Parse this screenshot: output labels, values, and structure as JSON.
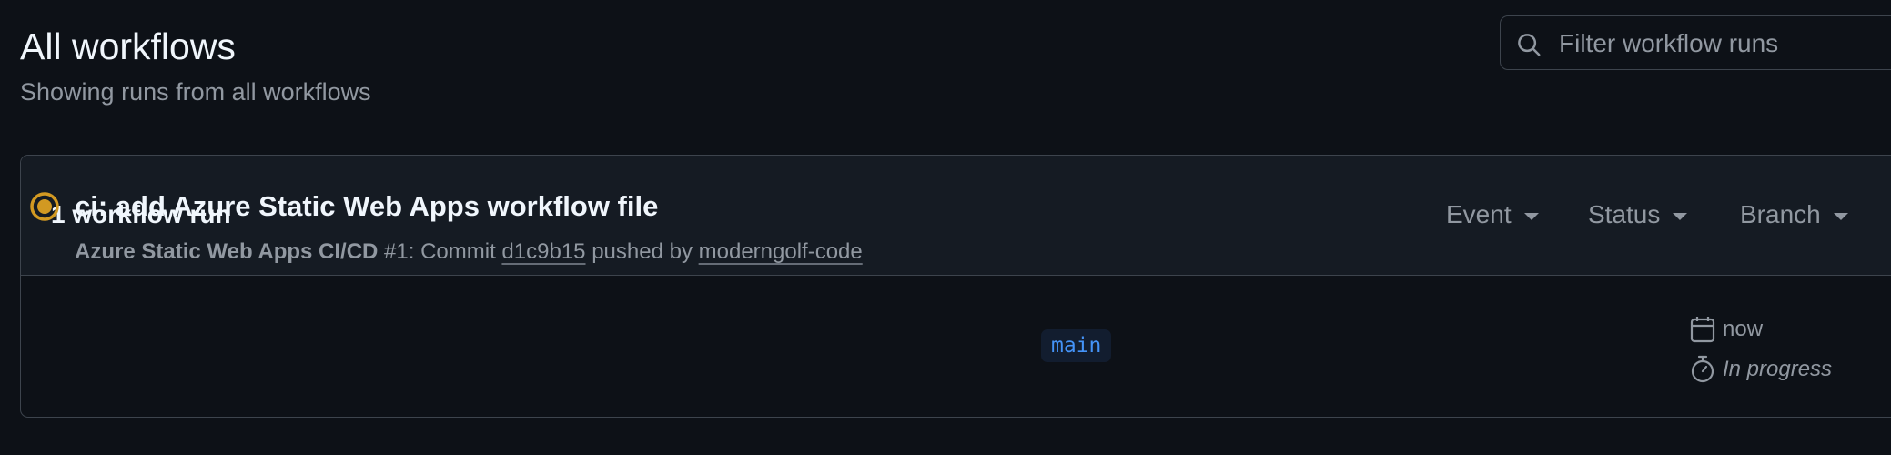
{
  "header": {
    "title": "All workflows",
    "subtitle": "Showing runs from all workflows"
  },
  "filter": {
    "placeholder": "Filter workflow runs",
    "icon": "search-icon"
  },
  "panel": {
    "run_count": "1 workflow run",
    "filters": [
      {
        "label": "Event"
      },
      {
        "label": "Status"
      },
      {
        "label": "Branch"
      }
    ]
  },
  "runs": [
    {
      "status": "in-progress",
      "status_color": "#d29922",
      "title": "ci: add Azure Static Web Apps workflow file",
      "workflow_name": "Azure Static Web Apps CI/CD",
      "run_number": "#1: Commit",
      "commit": "d1c9b15",
      "pushed_by_label": "pushed by",
      "author": "moderngolf-code",
      "branch": "main",
      "time": "now",
      "duration": "In progress"
    }
  ],
  "colors": {
    "background": "#0d1117",
    "header_background": "#151b23",
    "border": "#3d444d",
    "muted_text": "#9198a1",
    "accent_blue": "#4493f8",
    "in_progress": "#d29922"
  }
}
